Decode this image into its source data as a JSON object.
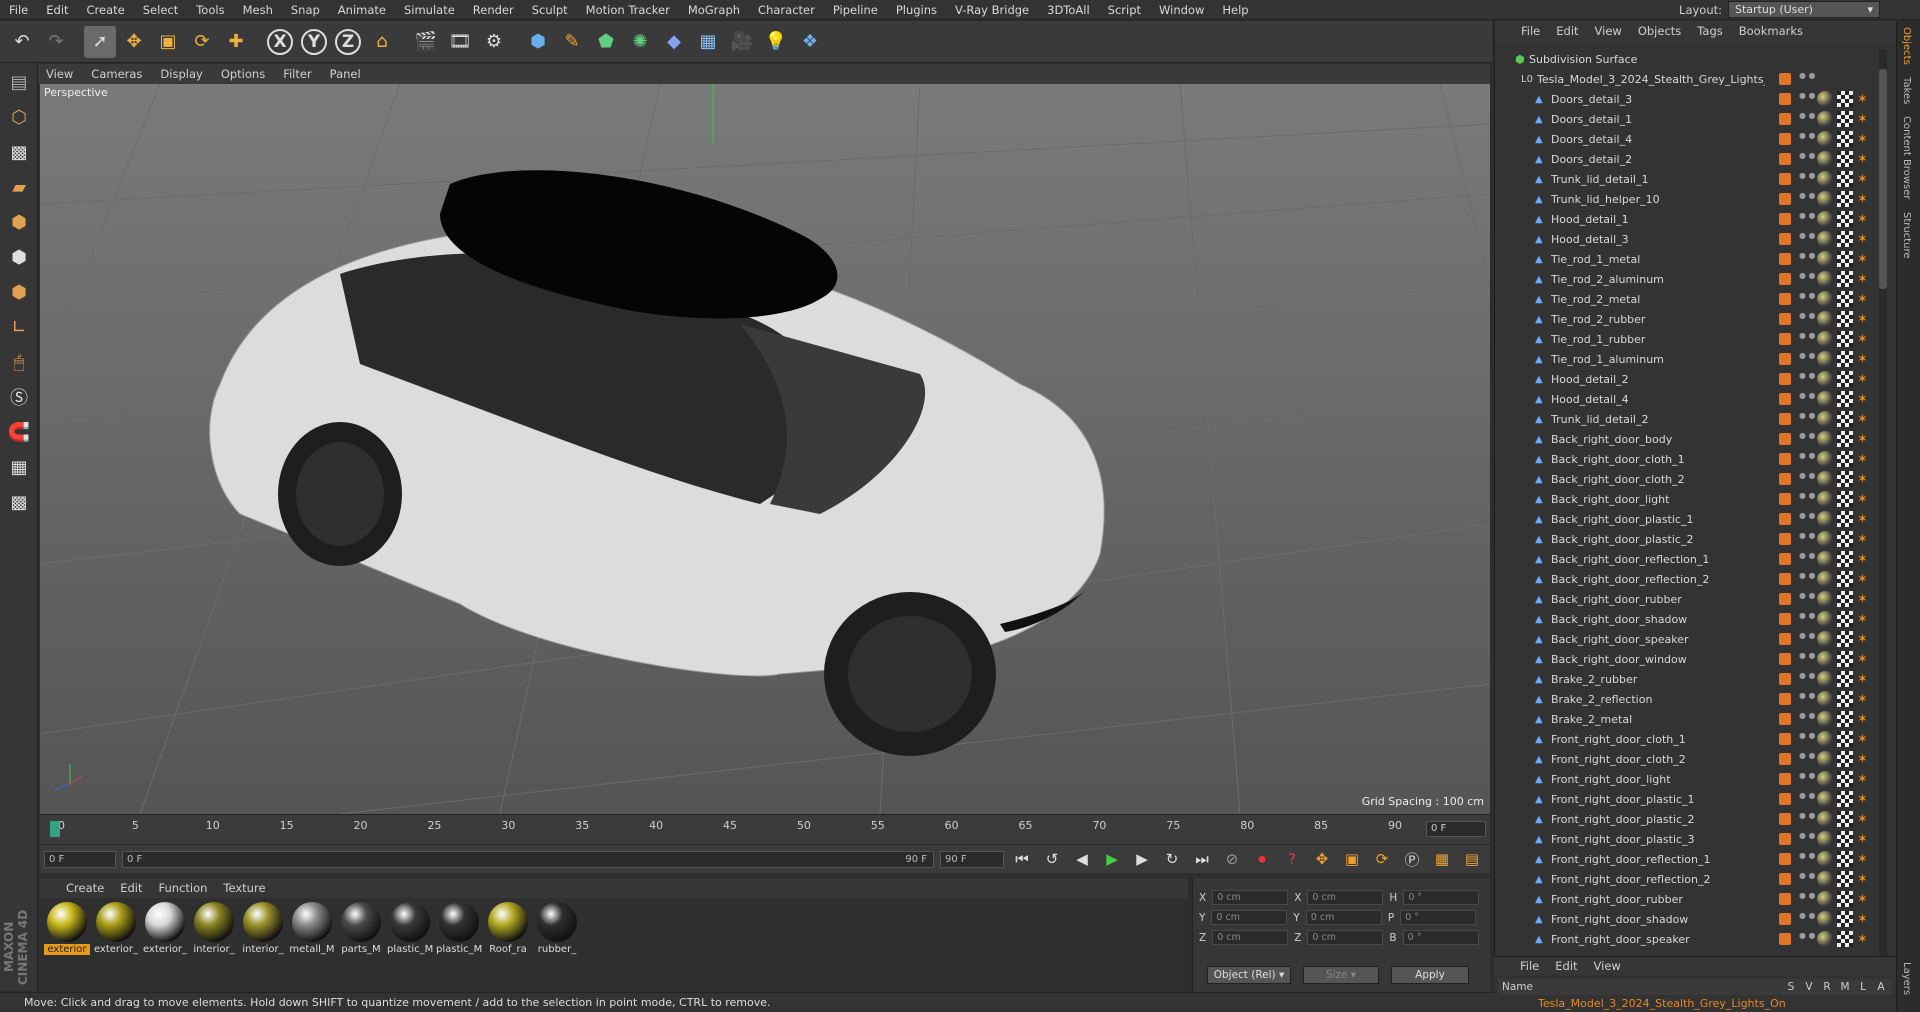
{
  "menu": [
    "File",
    "Edit",
    "Create",
    "Select",
    "Tools",
    "Mesh",
    "Snap",
    "Animate",
    "Simulate",
    "Render",
    "Sculpt",
    "Motion Tracker",
    "MoGraph",
    "Character",
    "Pipeline",
    "Plugins",
    "V-Ray Bridge",
    "3DToAll",
    "Script",
    "Window",
    "Help"
  ],
  "layout": {
    "label": "Layout:",
    "value": "Startup (User)"
  },
  "viewport": {
    "menu": [
      "View",
      "Cameras",
      "Display",
      "Options",
      "Filter",
      "Panel"
    ],
    "label": "Perspective",
    "grid_spacing": "Grid Spacing : 100 cm"
  },
  "timeline": {
    "ticks": [
      "0",
      "5",
      "10",
      "15",
      "20",
      "25",
      "30",
      "35",
      "40",
      "45",
      "50",
      "55",
      "60",
      "65",
      "70",
      "75",
      "80",
      "85",
      "90"
    ],
    "end_field": "0 F"
  },
  "transport": {
    "start": "0 F",
    "range_start": "0 F",
    "range_end": "90 F",
    "end": "90 F"
  },
  "material_menu": [
    "Create",
    "Edit",
    "Function",
    "Texture"
  ],
  "materials": [
    {
      "label": "exterior",
      "color": "#c8b818",
      "selected": true
    },
    {
      "label": "exterior_",
      "color": "#a89c14",
      "selected": false
    },
    {
      "label": "exterior_",
      "color": "#d8d8d8",
      "selected": false
    },
    {
      "label": "interior_",
      "color": "#8a8420",
      "selected": false
    },
    {
      "label": "interior_",
      "color": "#9a9028",
      "selected": false
    },
    {
      "label": "metall_M",
      "color": "#8a8a8a",
      "selected": false
    },
    {
      "label": "parts_M",
      "color": "#4a4a4a",
      "selected": false
    },
    {
      "label": "plastic_M",
      "color": "#3a3a3a",
      "selected": false
    },
    {
      "label": "plastic_M",
      "color": "#333333",
      "selected": false
    },
    {
      "label": "Roof_ra",
      "color": "#b0a820",
      "selected": false
    },
    {
      "label": "rubber_",
      "color": "#2e2e2e",
      "selected": false
    }
  ],
  "coords": {
    "rows": [
      {
        "a": "X",
        "av": "0 cm",
        "b": "X",
        "bv": "0 cm",
        "c": "H",
        "cv": "0 °"
      },
      {
        "a": "Y",
        "av": "0 cm",
        "b": "Y",
        "bv": "0 cm",
        "c": "P",
        "cv": "0 °"
      },
      {
        "a": "Z",
        "av": "0 cm",
        "b": "Z",
        "bv": "0 cm",
        "c": "B",
        "cv": "0 °"
      }
    ],
    "mode": "Object (Rel)",
    "size": "Size",
    "apply": "Apply"
  },
  "status": "Move: Click and drag to move elements. Hold down SHIFT to quantize movement / add to the selection in point mode, CTRL to remove.",
  "object_manager": {
    "menu": [
      "File",
      "Edit",
      "View",
      "Objects",
      "Tags",
      "Bookmarks"
    ],
    "root": "Subdivision Surface",
    "group": "Tesla_Model_3_2024_Stealth_Grey_Lights_On",
    "objects": [
      "Doors_detail_3",
      "Doors_detail_1",
      "Doors_detail_4",
      "Doors_detail_2",
      "Trunk_lid_detail_1",
      "Trunk_lid_helper_10",
      "Hood_detail_1",
      "Hood_detail_3",
      "Tie_rod_1_metal",
      "Tie_rod_2_aluminum",
      "Tie_rod_2_metal",
      "Tie_rod_2_rubber",
      "Tie_rod_1_rubber",
      "Tie_rod_1_aluminum",
      "Hood_detail_2",
      "Hood_detail_4",
      "Trunk_lid_detail_2",
      "Back_right_door_body",
      "Back_right_door_cloth_1",
      "Back_right_door_cloth_2",
      "Back_right_door_light",
      "Back_right_door_plastic_1",
      "Back_right_door_plastic_2",
      "Back_right_door_reflection_1",
      "Back_right_door_reflection_2",
      "Back_right_door_rubber",
      "Back_right_door_shadow",
      "Back_right_door_speaker",
      "Back_right_door_window",
      "Brake_2_rubber",
      "Brake_2_reflection",
      "Brake_2_metal",
      "Front_right_door_cloth_1",
      "Front_right_door_cloth_2",
      "Front_right_door_light",
      "Front_right_door_plastic_1",
      "Front_right_door_plastic_2",
      "Front_right_door_plastic_3",
      "Front_right_door_reflection_1",
      "Front_right_door_reflection_2",
      "Front_right_door_rubber",
      "Front_right_door_shadow",
      "Front_right_door_speaker"
    ]
  },
  "layers": {
    "menu": [
      "File",
      "Edit",
      "View"
    ],
    "columns": [
      "Name",
      "S",
      "V",
      "R",
      "M",
      "L",
      "A"
    ],
    "row": "Tesla_Model_3_2024_Stealth_Grey_Lights_On"
  },
  "right_tabs": [
    "Objects",
    "Takes",
    "Content Browser",
    "Structure"
  ],
  "right_tabs_bottom": [
    "Layers"
  ],
  "brand": "MAXON CINEMA 4D"
}
